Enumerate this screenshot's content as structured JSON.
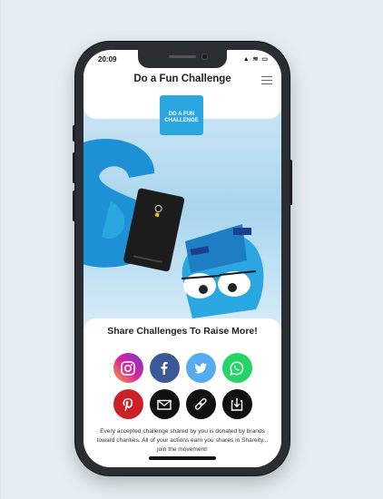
{
  "status": {
    "time": "20:09",
    "icons": "▲ ≋ ▭"
  },
  "header": {
    "title": "Do a Fun Challenge"
  },
  "logo": {
    "line1": "DO A FUN",
    "line2": "CHALLENGE"
  },
  "share": {
    "title": "Share Challenges To Raise More!",
    "buttons_row1": [
      {
        "name": "instagram",
        "color": "#c13584"
      },
      {
        "name": "facebook",
        "color": "#3b5998"
      },
      {
        "name": "twitter",
        "color": "#55acee"
      },
      {
        "name": "whatsapp",
        "color": "#25d366"
      }
    ],
    "buttons_row2": [
      {
        "name": "pinterest",
        "color": "#cb2027"
      },
      {
        "name": "email",
        "color": "#111111"
      },
      {
        "name": "link",
        "color": "#111111"
      },
      {
        "name": "share-download",
        "color": "#111111"
      }
    ],
    "note": "Every accepted challenge shared by you is donated by brands toward charities. All of your actions earn you shares in Shareity... join the movement!"
  },
  "colors": {
    "accent": "#2aa6e1",
    "text": "#222222"
  }
}
